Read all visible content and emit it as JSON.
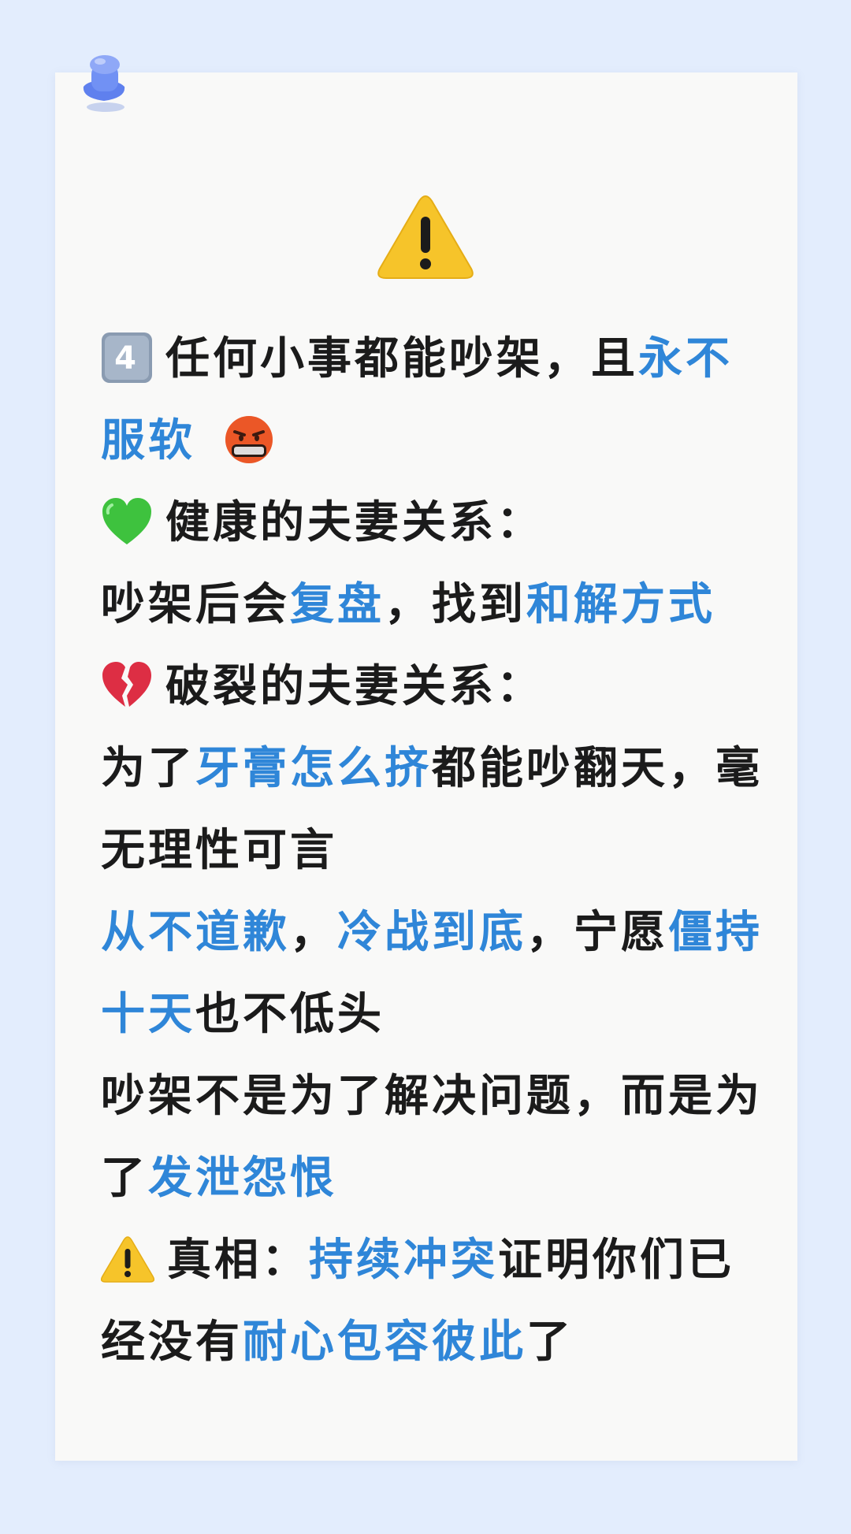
{
  "sections": {
    "s1": {
      "l1a": "任何小事都能吵架，且",
      "l1b": "永不",
      "l2a": "服软"
    },
    "s2": {
      "title": "健康的夫妻关系：",
      "body_a": "吵架后会",
      "body_b": "复盘",
      "body_c": "，找到",
      "body_d": "和解方式"
    },
    "s3": {
      "title": "破裂的夫妻关系：",
      "l1a": "为了",
      "l1b": "牙膏怎么挤",
      "l1c": "都能吵翻天，毫",
      "l2": "无理性可言",
      "l3a": "从不道歉",
      "l3b": "，",
      "l3c": "冷战到底",
      "l3d": "，宁愿",
      "l3e": "僵持",
      "l4a": "十天",
      "l4b": "也不低头",
      "l5": "吵架不是为了解决问题，而是为",
      "l6a": "了",
      "l6b": "发泄怨恨"
    },
    "s4": {
      "l1a": "真相：",
      "l1b": "持续冲突",
      "l1c": "证明你们已",
      "l2a": "经没有",
      "l2b": "耐心包容彼此",
      "l2c": "了"
    }
  },
  "icons": {
    "pin": "push-pin-icon",
    "warning": "warning-icon",
    "number": "keycap-4-icon",
    "swear": "cursing-face-icon",
    "heart": "green-heart-icon",
    "broken": "broken-heart-icon"
  },
  "colors": {
    "background": "#e3edfd",
    "card": "#f9f9f8",
    "text": "#1b1b1b",
    "highlight": "#2f86d8"
  }
}
